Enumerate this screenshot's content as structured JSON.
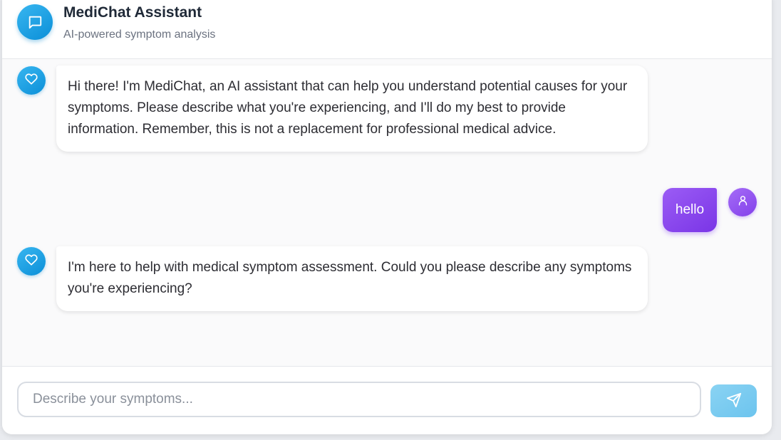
{
  "header": {
    "title": "MediChat Assistant",
    "subtitle": "AI-powered symptom analysis",
    "icon": "chat-bubble-icon"
  },
  "messages": [
    {
      "role": "assistant",
      "avatar_icon": "heart-icon",
      "text": "Hi there! I'm MediChat, an AI assistant that can help you understand potential causes for your symptoms. Please describe what you're experiencing, and I'll do my best to provide information. Remember, this is not a replacement for professional medical advice."
    },
    {
      "role": "user",
      "avatar_icon": "user-icon",
      "text": "hello"
    },
    {
      "role": "assistant",
      "avatar_icon": "heart-icon",
      "text": "I'm here to help with medical symptom assessment. Could you please describe any symptoms you're experiencing?"
    }
  ],
  "composer": {
    "value": "",
    "placeholder": "Describe your symptoms...",
    "send_icon": "send-icon"
  },
  "colors": {
    "assistant_accent": "#0ea5e9",
    "user_accent": "#7c3aed",
    "send_button": "#7dcbf0"
  }
}
